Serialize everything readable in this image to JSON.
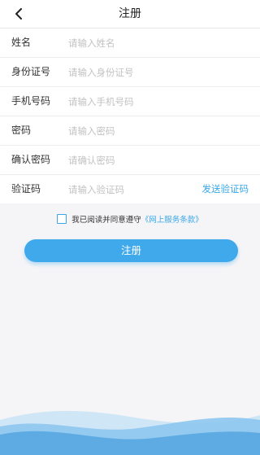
{
  "header": {
    "title": "注册",
    "back_icon": "chevron-left-icon"
  },
  "form": {
    "name": {
      "label": "姓名",
      "placeholder": "请输入姓名"
    },
    "id_number": {
      "label": "身份证号",
      "placeholder": "请输入身份证号"
    },
    "phone": {
      "label": "手机号码",
      "placeholder": "请输入手机号码"
    },
    "password": {
      "label": "密码",
      "placeholder": "请输入密码"
    },
    "confirm_password": {
      "label": "确认密码",
      "placeholder": "请确认密码"
    },
    "code": {
      "label": "验证码",
      "placeholder": "请输入验证码",
      "send_label": "发送验证码"
    }
  },
  "agreement": {
    "text": "我已阅读并同意遵守",
    "link": "《网上服务条款》",
    "checked": false
  },
  "submit_label": "注册",
  "colors": {
    "accent": "#3fa9ec",
    "wave_light": "#cfe6f7",
    "wave_mid": "#8dc7ee",
    "wave_dark": "#5aa9e0"
  }
}
